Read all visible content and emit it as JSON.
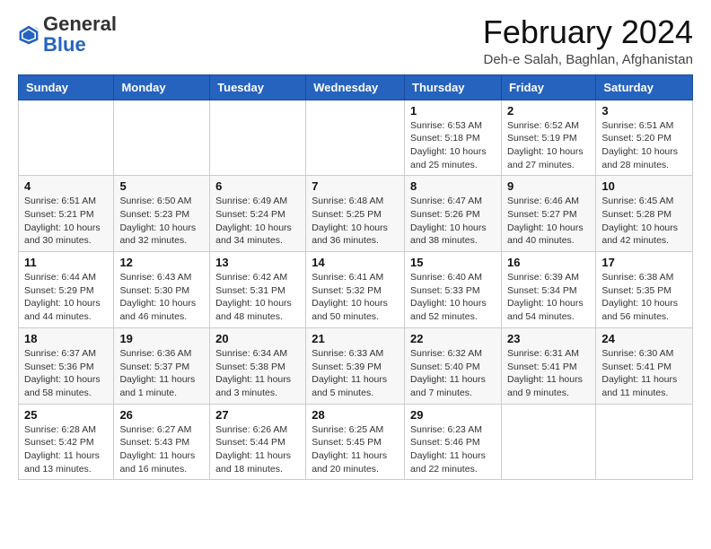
{
  "logo": {
    "general": "General",
    "blue": "Blue"
  },
  "header": {
    "title": "February 2024",
    "subtitle": "Deh-e Salah, Baghlan, Afghanistan"
  },
  "days_of_week": [
    "Sunday",
    "Monday",
    "Tuesday",
    "Wednesday",
    "Thursday",
    "Friday",
    "Saturday"
  ],
  "weeks": [
    [
      {
        "day": "",
        "info": ""
      },
      {
        "day": "",
        "info": ""
      },
      {
        "day": "",
        "info": ""
      },
      {
        "day": "",
        "info": ""
      },
      {
        "day": "1",
        "info": "Sunrise: 6:53 AM\nSunset: 5:18 PM\nDaylight: 10 hours and 25 minutes."
      },
      {
        "day": "2",
        "info": "Sunrise: 6:52 AM\nSunset: 5:19 PM\nDaylight: 10 hours and 27 minutes."
      },
      {
        "day": "3",
        "info": "Sunrise: 6:51 AM\nSunset: 5:20 PM\nDaylight: 10 hours and 28 minutes."
      }
    ],
    [
      {
        "day": "4",
        "info": "Sunrise: 6:51 AM\nSunset: 5:21 PM\nDaylight: 10 hours and 30 minutes."
      },
      {
        "day": "5",
        "info": "Sunrise: 6:50 AM\nSunset: 5:23 PM\nDaylight: 10 hours and 32 minutes."
      },
      {
        "day": "6",
        "info": "Sunrise: 6:49 AM\nSunset: 5:24 PM\nDaylight: 10 hours and 34 minutes."
      },
      {
        "day": "7",
        "info": "Sunrise: 6:48 AM\nSunset: 5:25 PM\nDaylight: 10 hours and 36 minutes."
      },
      {
        "day": "8",
        "info": "Sunrise: 6:47 AM\nSunset: 5:26 PM\nDaylight: 10 hours and 38 minutes."
      },
      {
        "day": "9",
        "info": "Sunrise: 6:46 AM\nSunset: 5:27 PM\nDaylight: 10 hours and 40 minutes."
      },
      {
        "day": "10",
        "info": "Sunrise: 6:45 AM\nSunset: 5:28 PM\nDaylight: 10 hours and 42 minutes."
      }
    ],
    [
      {
        "day": "11",
        "info": "Sunrise: 6:44 AM\nSunset: 5:29 PM\nDaylight: 10 hours and 44 minutes."
      },
      {
        "day": "12",
        "info": "Sunrise: 6:43 AM\nSunset: 5:30 PM\nDaylight: 10 hours and 46 minutes."
      },
      {
        "day": "13",
        "info": "Sunrise: 6:42 AM\nSunset: 5:31 PM\nDaylight: 10 hours and 48 minutes."
      },
      {
        "day": "14",
        "info": "Sunrise: 6:41 AM\nSunset: 5:32 PM\nDaylight: 10 hours and 50 minutes."
      },
      {
        "day": "15",
        "info": "Sunrise: 6:40 AM\nSunset: 5:33 PM\nDaylight: 10 hours and 52 minutes."
      },
      {
        "day": "16",
        "info": "Sunrise: 6:39 AM\nSunset: 5:34 PM\nDaylight: 10 hours and 54 minutes."
      },
      {
        "day": "17",
        "info": "Sunrise: 6:38 AM\nSunset: 5:35 PM\nDaylight: 10 hours and 56 minutes."
      }
    ],
    [
      {
        "day": "18",
        "info": "Sunrise: 6:37 AM\nSunset: 5:36 PM\nDaylight: 10 hours and 58 minutes."
      },
      {
        "day": "19",
        "info": "Sunrise: 6:36 AM\nSunset: 5:37 PM\nDaylight: 11 hours and 1 minute."
      },
      {
        "day": "20",
        "info": "Sunrise: 6:34 AM\nSunset: 5:38 PM\nDaylight: 11 hours and 3 minutes."
      },
      {
        "day": "21",
        "info": "Sunrise: 6:33 AM\nSunset: 5:39 PM\nDaylight: 11 hours and 5 minutes."
      },
      {
        "day": "22",
        "info": "Sunrise: 6:32 AM\nSunset: 5:40 PM\nDaylight: 11 hours and 7 minutes."
      },
      {
        "day": "23",
        "info": "Sunrise: 6:31 AM\nSunset: 5:41 PM\nDaylight: 11 hours and 9 minutes."
      },
      {
        "day": "24",
        "info": "Sunrise: 6:30 AM\nSunset: 5:41 PM\nDaylight: 11 hours and 11 minutes."
      }
    ],
    [
      {
        "day": "25",
        "info": "Sunrise: 6:28 AM\nSunset: 5:42 PM\nDaylight: 11 hours and 13 minutes."
      },
      {
        "day": "26",
        "info": "Sunrise: 6:27 AM\nSunset: 5:43 PM\nDaylight: 11 hours and 16 minutes."
      },
      {
        "day": "27",
        "info": "Sunrise: 6:26 AM\nSunset: 5:44 PM\nDaylight: 11 hours and 18 minutes."
      },
      {
        "day": "28",
        "info": "Sunrise: 6:25 AM\nSunset: 5:45 PM\nDaylight: 11 hours and 20 minutes."
      },
      {
        "day": "29",
        "info": "Sunrise: 6:23 AM\nSunset: 5:46 PM\nDaylight: 11 hours and 22 minutes."
      },
      {
        "day": "",
        "info": ""
      },
      {
        "day": "",
        "info": ""
      }
    ]
  ]
}
